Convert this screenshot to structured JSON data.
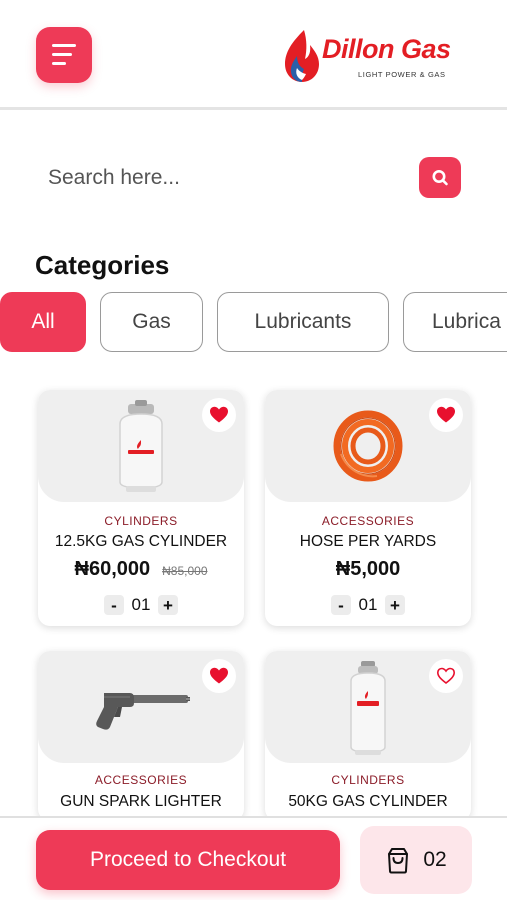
{
  "header": {
    "menu_icon": "hamburger-menu-icon",
    "logo_text": "Dillon Gas",
    "logo_tagline": "LIGHT POWER & GAS"
  },
  "search": {
    "placeholder": "Search here...",
    "icon": "search-icon"
  },
  "categories": {
    "title": "Categories",
    "chips": [
      {
        "label": "All",
        "active": true
      },
      {
        "label": "Gas",
        "active": false
      },
      {
        "label": "Lubricants",
        "active": false
      },
      {
        "label": "Lubrica",
        "active": false
      }
    ]
  },
  "products": [
    {
      "category": "CYLINDERS",
      "name": "12.5KG GAS CYLINDER",
      "price": "₦60,000",
      "old_price": "₦85,000",
      "qty": "01",
      "favorited": true,
      "image": "gas-cylinder"
    },
    {
      "category": "ACCESSORIES",
      "name": "HOSE PER YARDS",
      "price": "₦5,000",
      "qty": "01",
      "favorited": true,
      "image": "gas-hose"
    },
    {
      "category": "ACCESSORIES",
      "name": "GUN SPARK LIGHTER",
      "favorited": true,
      "image": "spark-lighter"
    },
    {
      "category": "CYLINDERS",
      "name": "50KG GAS CYLINDER",
      "favorited": false,
      "image": "tall-gas-cylinder"
    }
  ],
  "qty_controls": {
    "minus": "-",
    "plus": "+"
  },
  "footer": {
    "checkout_label": "Proceed to Checkout",
    "cart_icon": "shopping-bag-icon",
    "cart_count": "02"
  },
  "colors": {
    "accent": "#ee3a57",
    "accent_light": "#fde6ea",
    "category_label": "#8b1c28",
    "logo_red": "#e31e24"
  }
}
